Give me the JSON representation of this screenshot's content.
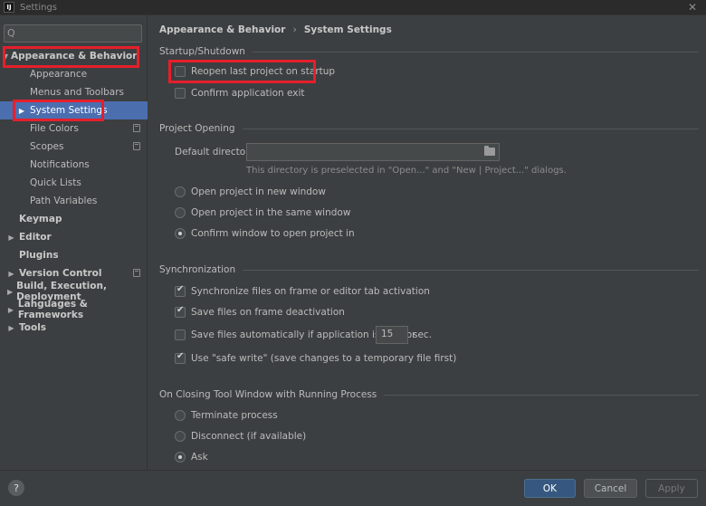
{
  "window": {
    "title": "Settings",
    "app_icon": "IJ",
    "close_glyph": "✕"
  },
  "sidebar": {
    "search_placeholder": "",
    "search_icon_glyph": "Q",
    "items": [
      {
        "label": "Appearance & Behavior",
        "bold": true,
        "arrow": "▼"
      },
      {
        "label": "Appearance"
      },
      {
        "label": "Menus and Toolbars"
      },
      {
        "label": "System Settings",
        "selected": true,
        "arrow": "▶"
      },
      {
        "label": "File Colors",
        "copy": true
      },
      {
        "label": "Scopes",
        "copy": true
      },
      {
        "label": "Notifications"
      },
      {
        "label": "Quick Lists"
      },
      {
        "label": "Path Variables"
      },
      {
        "label": "Keymap",
        "bold": true
      },
      {
        "label": "Editor",
        "bold": true,
        "arrow": "▶"
      },
      {
        "label": "Plugins",
        "bold": true
      },
      {
        "label": "Version Control",
        "bold": true,
        "arrow": "▶",
        "copy": true
      },
      {
        "label": "Build, Execution, Deployment",
        "bold": true,
        "arrow": "▶"
      },
      {
        "label": "Languages & Frameworks",
        "bold": true,
        "arrow": "▶"
      },
      {
        "label": "Tools",
        "bold": true,
        "arrow": "▶"
      }
    ]
  },
  "breadcrumb": {
    "part1": "Appearance & Behavior",
    "sep": "›",
    "part2": "System Settings"
  },
  "startup": {
    "heading": "Startup/Shutdown",
    "reopen_label": "Reopen last project on startup",
    "reopen_checked": false,
    "confirm_exit_label": "Confirm application exit",
    "confirm_exit_checked": false
  },
  "project_opening": {
    "heading": "Project Opening",
    "default_dir_label": "Default directory:",
    "default_dir_value": "",
    "hint": "This directory is preselected in \"Open...\" and \"New | Project...\" dialogs.",
    "options": [
      {
        "label": "Open project in new window",
        "checked": false
      },
      {
        "label": "Open project in the same window",
        "checked": false
      },
      {
        "label": "Confirm window to open project in",
        "checked": true
      }
    ]
  },
  "sync": {
    "heading": "Synchronization",
    "sync_frame_label": "Synchronize files on frame or editor tab activation",
    "sync_frame_checked": true,
    "save_deactivation_label": "Save files on frame deactivation",
    "save_deactivation_checked": true,
    "auto_save_label": "Save files automatically if application is idle for",
    "auto_save_checked": false,
    "idle_seconds": "15",
    "idle_unit": "sec.",
    "safe_write_label": "Use \"safe write\" (save changes to a temporary file first)",
    "safe_write_checked": true
  },
  "closing": {
    "heading": "On Closing Tool Window with Running Process",
    "options": [
      {
        "label": "Terminate process",
        "checked": false
      },
      {
        "label": "Disconnect (if available)",
        "checked": false
      },
      {
        "label": "Ask",
        "checked": true
      }
    ]
  },
  "buttons": {
    "help": "?",
    "ok": "OK",
    "cancel": "Cancel",
    "apply": "Apply"
  },
  "colors": {
    "accent": "#4b6eaf",
    "primary_button": "#365880",
    "highlight_box": "#e51f2b"
  }
}
